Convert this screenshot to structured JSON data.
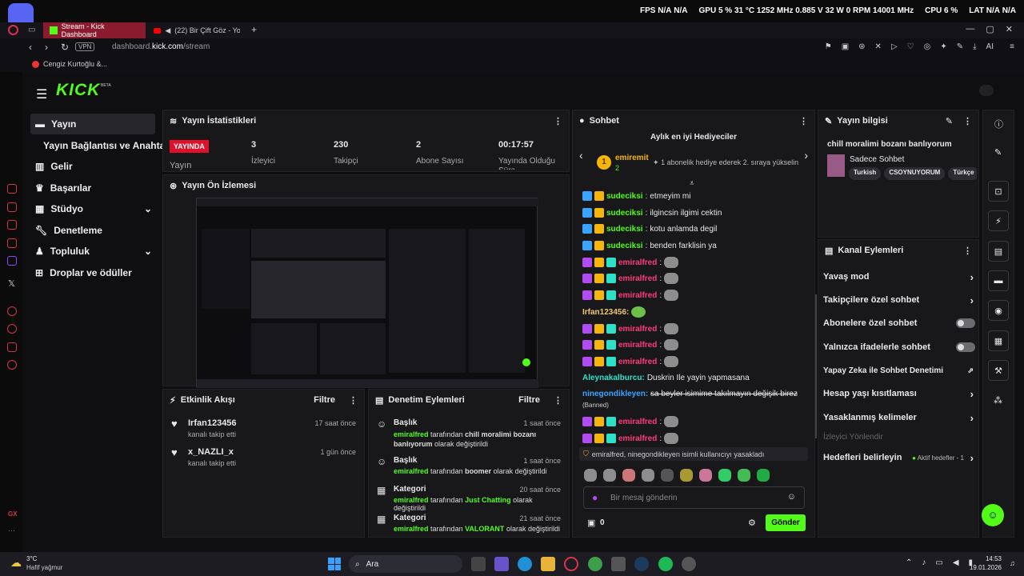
{
  "hud": {
    "fps_label": "FPS",
    "fps_value": "N/A",
    "fps_value2": "N/A",
    "gpu_label": "GPU",
    "gpu_load": "5 %",
    "gpu_temp": "31 °C",
    "gpu_clock": "1252 MHz",
    "gpu_volt": "0.885 V",
    "gpu_power": "32 W",
    "gpu_fan": "0 RPM",
    "gpu_mem": "14001 MHz",
    "cpu_label": "CPU",
    "cpu_load": "6 %",
    "lat_label": "LAT",
    "lat_value": "N/A",
    "lat_value2": "N/A"
  },
  "browser": {
    "tab1": "Stream - Kick Dashboard",
    "tab2": "(22) Bir Çift Göz - You",
    "url_prefix": "dashboard.",
    "url_domain": "kick.com",
    "url_path": "/stream",
    "vpn": "VPN",
    "bookmark1": "Cengiz Kurtoğlu &...",
    "ai_label": "AI"
  },
  "kick": {
    "logo": "KICK",
    "beta": "BETA"
  },
  "nav": {
    "yayin": "Yayın",
    "baglanti": "Yayın Bağlantısı ve Anahtarı",
    "gelir": "Gelir",
    "basarilar": "Başarılar",
    "studyo": "Stüdyo",
    "denetleme": "Denetleme",
    "topluluk": "Topluluk",
    "droplar": "Droplar ve ödüller"
  },
  "stats": {
    "title": "Yayın İstatistikleri",
    "live_badge": "YAYINDA",
    "live_label": "Yayın",
    "viewers": "3",
    "viewers_label": "İzleyici",
    "followers": "230",
    "followers_label": "Takipçi",
    "subs": "2",
    "subs_label": "Abone Sayısı",
    "duration": "00:17:57",
    "duration_label": "Yayında Olduğu Süre"
  },
  "preview": {
    "title": "Yayın Ön İzlemesi"
  },
  "activity": {
    "title": "Etkinlik Akışı",
    "filter": "Filtre",
    "items": [
      {
        "user": "Irfan123456",
        "desc": "kanalı takip etti",
        "time": "17 saat önce"
      },
      {
        "user": "x_NAZLI_x",
        "desc": "kanalı takip etti",
        "time": "1 gün önce"
      }
    ]
  },
  "modlog": {
    "title": "Denetim Eylemleri",
    "filter": "Filtre",
    "items": [
      {
        "type": "Başlık",
        "time": "1 saat önce",
        "who": "emiralfred",
        "mid": "tarafından",
        "what": "chill moralimi bozanı banlıyorum",
        "tail": "olarak değiştirildi"
      },
      {
        "type": "Başlık",
        "time": "1 saat önce",
        "who": "emiralfred",
        "mid": "tarafından",
        "what": "boomer",
        "tail": "olarak değiştirildi"
      },
      {
        "type": "Kategori",
        "time": "20 saat önce",
        "who": "emiralfred",
        "mid": "tarafından",
        "what": "Just Chatting",
        "tail": "olarak değiştirildi"
      },
      {
        "type": "Kategori",
        "time": "21 saat önce",
        "who": "emiralfred",
        "mid": "tarafından",
        "what": "VALORANT",
        "tail": "olarak değiştirildi"
      }
    ]
  },
  "chat": {
    "title": "Sohbet",
    "gifters_title": "Aylık en iyi Hediyeciler",
    "top_rank": "1",
    "top_user": "emiremit",
    "top_count": "2",
    "gift_note": "1 abonelik hediye ederek 2. sıraya yükselin",
    "messages": [
      {
        "user": "sudeciksi",
        "text": "etmeyim mi"
      },
      {
        "user": "sudeciksi",
        "text": "ilgincsin ilgimi cektin"
      },
      {
        "user": "sudeciksi",
        "text": "kotu anlamda degil"
      },
      {
        "user": "sudeciksi",
        "text": "benden farklisin ya"
      }
    ],
    "emiral": "emiralfred",
    "irfan": "Irfan123456:",
    "aleyna_user": "Aleynakalburcu:",
    "aleyna_text": "Duskrin Ile yayin yapmasana",
    "banned_user": "ninegondikleyen:",
    "banned_text": "sa beyler isimime takılmayın değişik birez",
    "banned_tag": "(Banned)",
    "ban_notice": "emiralfred, ninegondikleyen isimli kullanıcıyı yasakladı",
    "input_placeholder": "Bir mesaj gönderin",
    "points": "0",
    "send": "Gönder"
  },
  "info": {
    "title": "Yayın bilgisi",
    "stream_title": "chill moralimi bozanı banlıyorum",
    "category": "Sadece Sohbet",
    "tags": [
      "Turkish",
      "CSOYNUYORUM",
      "Türkçe"
    ]
  },
  "channel": {
    "title": "Kanal Eylemleri",
    "slow": "Yavaş mod",
    "followers_only": "Takipçilere özel sohbet",
    "subs_only": "Abonelere özel sohbet",
    "emote_only": "Yalnızca ifadelerle sohbet",
    "ai_mod": "Yapay Zeka ile Sohbet Denetimi",
    "age": "Hesap yaşı kısıtlaması",
    "banned_words": "Yasaklanmış kelimeler",
    "raid": "İzleyici Yönlendir",
    "goals": "Hedefleri belirleyin",
    "goals_active": "Aktif hedefler - 1"
  },
  "taskbar": {
    "temp": "3°C",
    "weather": "Hafif yağmur",
    "search": "Ara",
    "time": "14:53",
    "date": "19.01.2026"
  },
  "colors": {
    "kick_green": "#53fc18",
    "live_red": "#e0102a",
    "opera_red": "#d9334a"
  }
}
